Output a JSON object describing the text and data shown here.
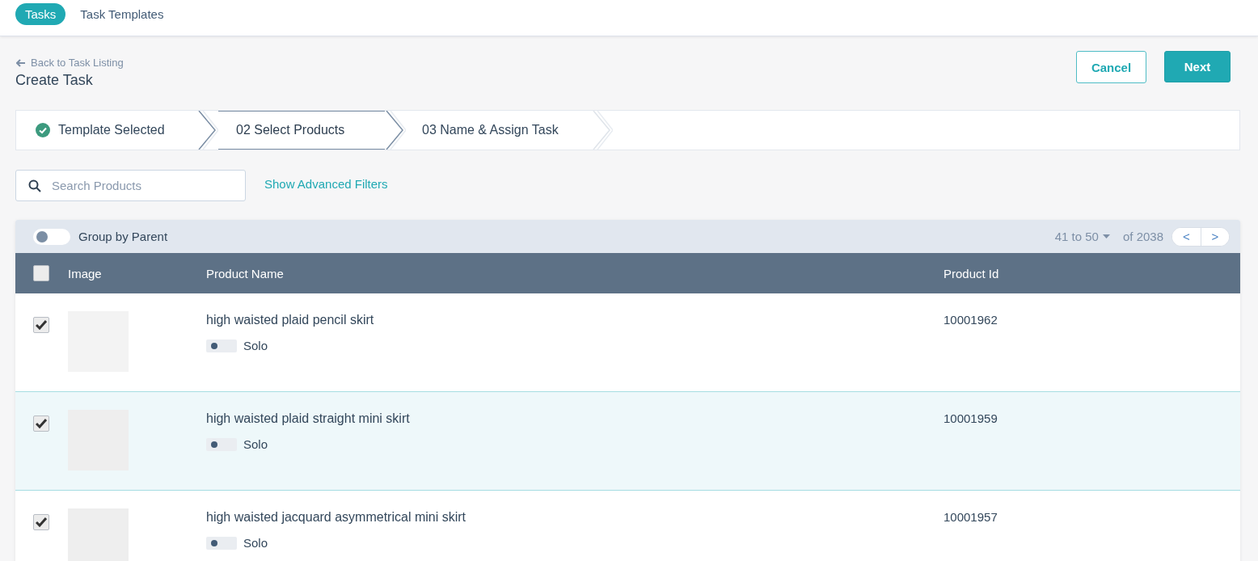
{
  "nav_tabs": [
    {
      "label": "Tasks",
      "selected": true
    },
    {
      "label": "Task Templates",
      "selected": false
    }
  ],
  "back_link": "Back to Task Listing",
  "page_title": "Create Task",
  "buttons": [
    {
      "label": "Cancel",
      "kind": "secondary"
    },
    {
      "label": "Next",
      "kind": "primary"
    }
  ],
  "steps": [
    {
      "label": "Template Selected",
      "completed": true,
      "selected": false
    },
    {
      "label": "02 Select Products",
      "completed": false,
      "selected": true
    },
    {
      "label": "03 Name & Assign Task",
      "completed": false,
      "selected": false
    }
  ],
  "search": {
    "placeholder": "Search Products"
  },
  "advanced_filters_link": "Show Advanced Filters",
  "group_by_parent": {
    "label": "Group by Parent",
    "on": false
  },
  "pagination": {
    "range": "41 to 50",
    "total": "of 2038",
    "prev": "<",
    "next": ">"
  },
  "table": {
    "select_all_checked": false,
    "columns": [
      "Image",
      "Product Name",
      "Product Id"
    ],
    "rows": [
      {
        "name": "high waisted plaid pencil skirt",
        "tag": "Solo",
        "tag_on": false,
        "id": "10001962",
        "checked": true,
        "highlighted": false
      },
      {
        "name": "high waisted plaid straight mini skirt",
        "tag": "Solo",
        "tag_on": false,
        "id": "10001959",
        "checked": true,
        "highlighted": true
      },
      {
        "name": "high waisted jacquard asymmetrical mini skirt",
        "tag": "Solo",
        "tag_on": false,
        "id": "10001957",
        "checked": true,
        "highlighted": false
      }
    ]
  }
}
